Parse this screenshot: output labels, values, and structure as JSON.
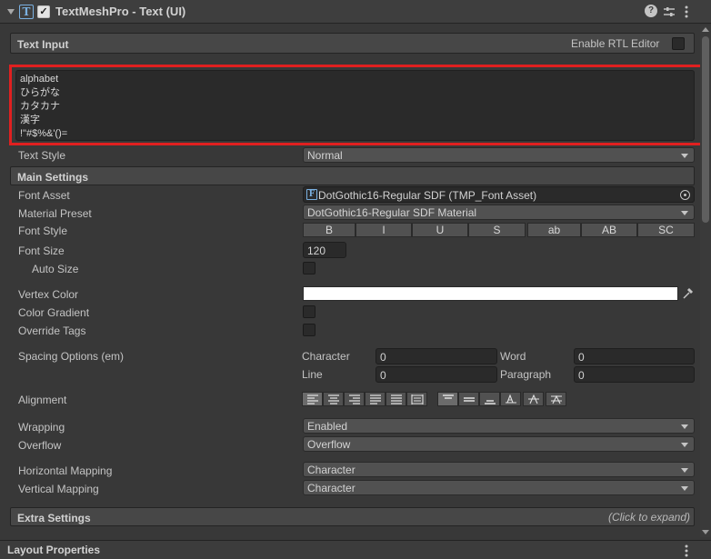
{
  "header": {
    "component_title": "TextMeshPro - Text (UI)",
    "enabled": true,
    "icons": [
      "tmp-text-icon",
      "help-icon",
      "presets-icon",
      "more-icon"
    ]
  },
  "text_input": {
    "section_title": "Text Input",
    "rtl_label": "Enable RTL Editor",
    "rtl_enabled": false,
    "lines": [
      "alphabet",
      "ひらがな",
      "カタカナ",
      "漢字",
      "!\"#$%&'()="
    ],
    "highlight_color": "#e02020"
  },
  "text_style": {
    "label": "Text Style",
    "value": "Normal"
  },
  "main_settings": {
    "section_title": "Main Settings",
    "font_asset": {
      "label": "Font Asset",
      "value": "DotGothic16-Regular SDF (TMP_Font Asset)"
    },
    "material_preset": {
      "label": "Material Preset",
      "value": "DotGothic16-Regular SDF Material"
    },
    "font_style": {
      "label": "Font Style",
      "buttons": [
        "B",
        "I",
        "U",
        "S",
        "ab",
        "AB",
        "SC"
      ]
    },
    "font_size": {
      "label": "Font Size",
      "value": "120"
    },
    "auto_size": {
      "label": "Auto Size",
      "checked": false
    },
    "vertex_color": {
      "label": "Vertex Color",
      "color": "#ffffff"
    },
    "color_gradient": {
      "label": "Color Gradient",
      "checked": false
    },
    "override_tags": {
      "label": "Override Tags",
      "checked": false
    },
    "spacing": {
      "label": "Spacing Options (em)",
      "character_label": "Character",
      "character_value": "0",
      "word_label": "Word",
      "word_value": "0",
      "line_label": "Line",
      "line_value": "0",
      "paragraph_label": "Paragraph",
      "paragraph_value": "0"
    },
    "alignment": {
      "label": "Alignment",
      "horizontal": [
        "align-left-icon",
        "align-center-icon",
        "align-right-icon",
        "align-justified-icon",
        "align-flush-icon",
        "align-geometry-center-icon"
      ],
      "vertical": [
        "align-top-icon",
        "align-middle-icon",
        "align-bottom-icon",
        "align-baseline-icon",
        "align-midline-icon",
        "align-capline-icon"
      ],
      "active_horizontal": 0,
      "active_vertical": 0
    },
    "wrapping": {
      "label": "Wrapping",
      "value": "Enabled"
    },
    "overflow": {
      "label": "Overflow",
      "value": "Overflow"
    },
    "horizontal_mapping": {
      "label": "Horizontal Mapping",
      "value": "Character"
    },
    "vertical_mapping": {
      "label": "Vertical Mapping",
      "value": "Character"
    }
  },
  "extra_settings": {
    "section_title": "Extra Settings",
    "hint": "(Click to expand)"
  },
  "layout_properties": {
    "title": "Layout Properties"
  }
}
